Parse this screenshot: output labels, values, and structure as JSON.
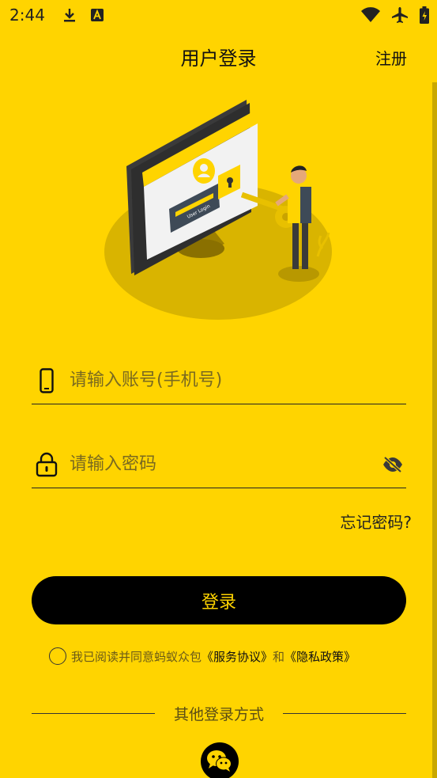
{
  "status_bar": {
    "time": "2:44",
    "icons": [
      "download-icon",
      "a-font-icon",
      "wifi-icon",
      "airplane-icon",
      "battery-icon"
    ]
  },
  "header": {
    "title": "用户登录",
    "register_label": "注册"
  },
  "hero": {
    "screen_text": "User Login",
    "image_name": "user-login-illustration"
  },
  "form": {
    "account_placeholder": "请输入账号(手机号)",
    "password_placeholder": "请输入密码",
    "account_icon": "phone-icon",
    "password_icon": "lock-icon",
    "password_toggle_icon": "eye-off-icon"
  },
  "forgot_password": "忘记密码?",
  "login_button": "登录",
  "agreement": {
    "prefix": "我已阅读并同意蚂蚁众包",
    "service_link": "《服务协议》",
    "and": "和",
    "privacy_link": "《隐私政策》",
    "checked": false
  },
  "other_login": {
    "label": "其他登录方式",
    "wechat_icon": "wechat-icon"
  },
  "colors": {
    "background": "#FFD400",
    "button": "#000000",
    "button_text": "#FFD400"
  }
}
